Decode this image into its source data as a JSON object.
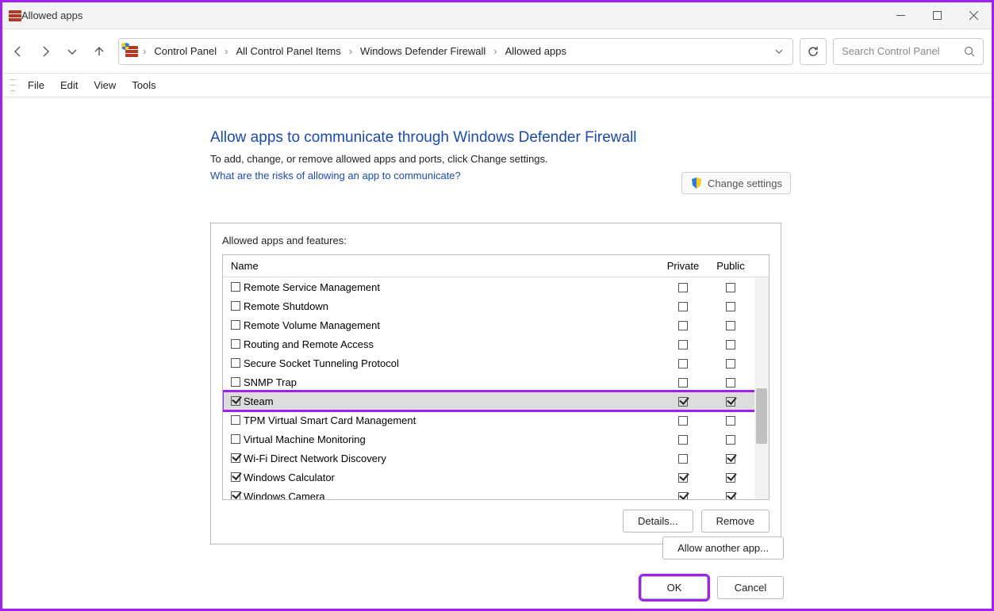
{
  "window": {
    "title": "Allowed apps"
  },
  "breadcrumb": {
    "items": [
      "Control Panel",
      "All Control Panel Items",
      "Windows Defender Firewall",
      "Allowed apps"
    ]
  },
  "search": {
    "placeholder": "Search Control Panel"
  },
  "menu": {
    "file": "File",
    "edit": "Edit",
    "view": "View",
    "tools": "Tools"
  },
  "page": {
    "heading": "Allow apps to communicate through Windows Defender Firewall",
    "subheading": "To add, change, or remove allowed apps and ports, click Change settings.",
    "risks_link": "What are the risks of allowing an app to communicate?",
    "change_settings": "Change settings",
    "groupbox_title": "Allowed apps and features:",
    "columns": {
      "name": "Name",
      "private": "Private",
      "public": "Public"
    },
    "rows": [
      {
        "enabled": false,
        "name": "Remote Service Management",
        "private": false,
        "public": false,
        "selected": false
      },
      {
        "enabled": false,
        "name": "Remote Shutdown",
        "private": false,
        "public": false,
        "selected": false
      },
      {
        "enabled": false,
        "name": "Remote Volume Management",
        "private": false,
        "public": false,
        "selected": false
      },
      {
        "enabled": false,
        "name": "Routing and Remote Access",
        "private": false,
        "public": false,
        "selected": false
      },
      {
        "enabled": false,
        "name": "Secure Socket Tunneling Protocol",
        "private": false,
        "public": false,
        "selected": false
      },
      {
        "enabled": false,
        "name": "SNMP Trap",
        "private": false,
        "public": false,
        "selected": false
      },
      {
        "enabled": true,
        "name": "Steam",
        "private": true,
        "public": true,
        "selected": true,
        "highlight": true
      },
      {
        "enabled": false,
        "name": "TPM Virtual Smart Card Management",
        "private": false,
        "public": false,
        "selected": false
      },
      {
        "enabled": false,
        "name": "Virtual Machine Monitoring",
        "private": false,
        "public": false,
        "selected": false
      },
      {
        "enabled": true,
        "name": "Wi-Fi Direct Network Discovery",
        "private": false,
        "public": true,
        "selected": false
      },
      {
        "enabled": true,
        "name": "Windows Calculator",
        "private": true,
        "public": true,
        "selected": false
      },
      {
        "enabled": true,
        "name": "Windows Camera",
        "private": true,
        "public": true,
        "selected": false
      }
    ],
    "details_btn": "Details...",
    "remove_btn": "Remove",
    "allow_another_btn": "Allow another app...",
    "ok_btn": "OK",
    "cancel_btn": "Cancel"
  }
}
